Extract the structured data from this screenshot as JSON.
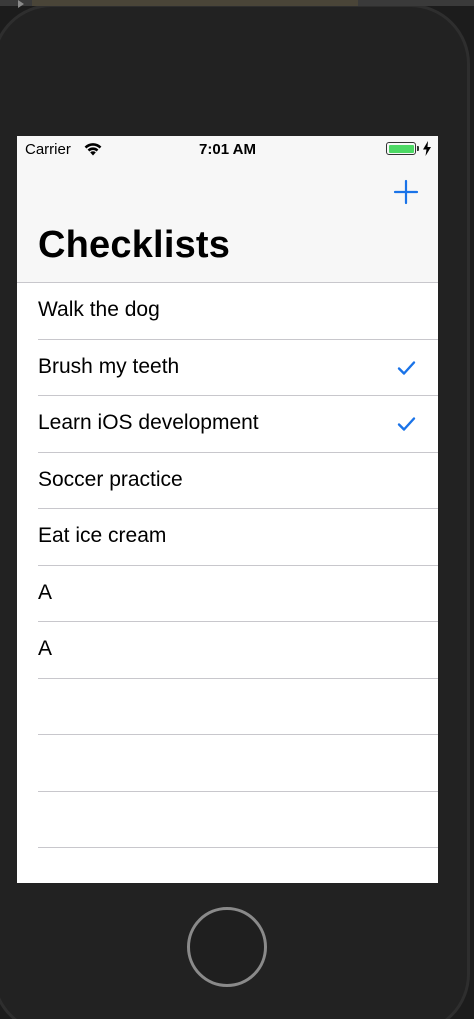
{
  "status_bar": {
    "carrier": "Carrier",
    "time": "7:01 AM",
    "battery_color": "#4cd964"
  },
  "nav": {
    "title": "Checklists",
    "add_icon": "plus-icon",
    "accent_color": "#1a73e8"
  },
  "items": [
    {
      "text": "Walk the dog",
      "checked": false
    },
    {
      "text": "Brush my teeth",
      "checked": true
    },
    {
      "text": "Learn iOS development",
      "checked": true
    },
    {
      "text": "Soccer practice",
      "checked": false
    },
    {
      "text": "Eat ice cream",
      "checked": false
    },
    {
      "text": "A",
      "checked": false
    },
    {
      "text": "A",
      "checked": false
    },
    {
      "text": "",
      "checked": false
    },
    {
      "text": "",
      "checked": false
    },
    {
      "text": "",
      "checked": false
    },
    {
      "text": "",
      "checked": false
    }
  ]
}
